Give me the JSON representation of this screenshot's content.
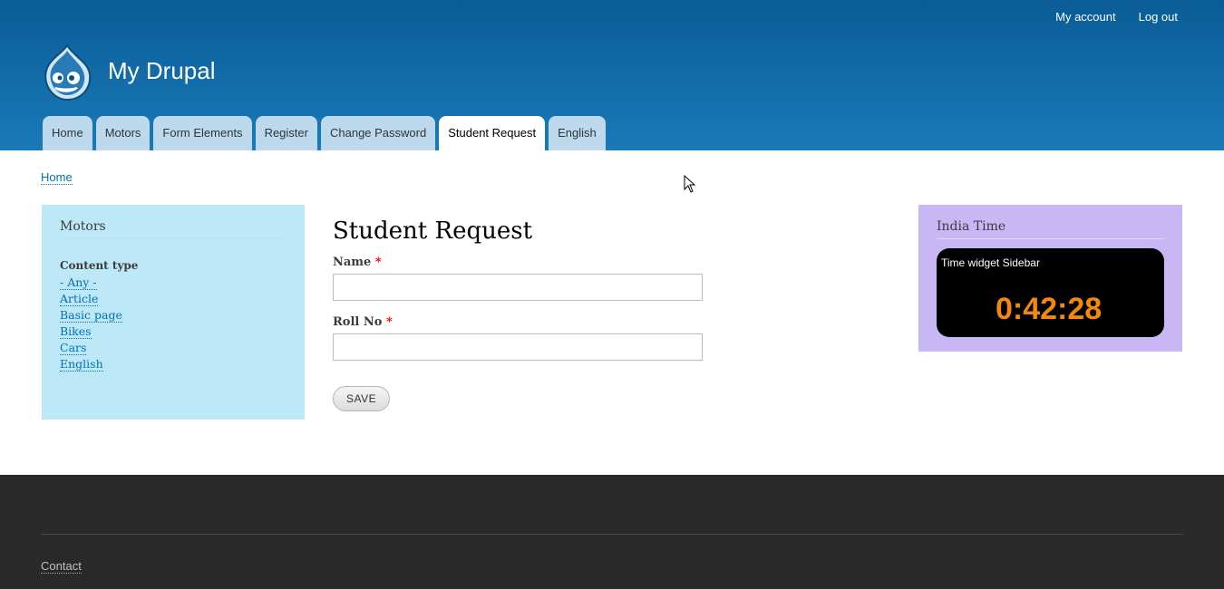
{
  "header": {
    "secondary_menu": [
      "My account",
      "Log out"
    ],
    "site_name": "My Drupal",
    "main_menu": [
      {
        "label": "Home",
        "active": false
      },
      {
        "label": "Motors",
        "active": false
      },
      {
        "label": "Form Elements",
        "active": false
      },
      {
        "label": "Register",
        "active": false
      },
      {
        "label": "Change Password",
        "active": false
      },
      {
        "label": "Student Request",
        "active": true
      },
      {
        "label": "English",
        "active": false
      }
    ]
  },
  "breadcrumb": "Home",
  "sidebar_left": {
    "title": "Motors",
    "facet_heading": "Content type",
    "items": [
      "- Any -",
      "Article",
      "Basic page",
      "Bikes",
      "Cars",
      "English"
    ]
  },
  "content": {
    "title": "Student Request",
    "fields": [
      {
        "label": "Name",
        "required_mark": "*",
        "value": ""
      },
      {
        "label": "Roll No",
        "required_mark": "*",
        "value": ""
      }
    ],
    "save_label": "SAVE"
  },
  "sidebar_right": {
    "title": "India Time",
    "widget_title": "Time widget Sidebar",
    "time": "0:42:28"
  },
  "footer": {
    "link": "Contact"
  },
  "colors": {
    "header_top": "#0a5c96",
    "header_bottom": "#1a7ab8",
    "left_sidebar_bg": "#bde8f7",
    "right_sidebar_bg": "#c8b6f5",
    "clock_color": "#f08a0a",
    "footer_bg": "#292929"
  }
}
